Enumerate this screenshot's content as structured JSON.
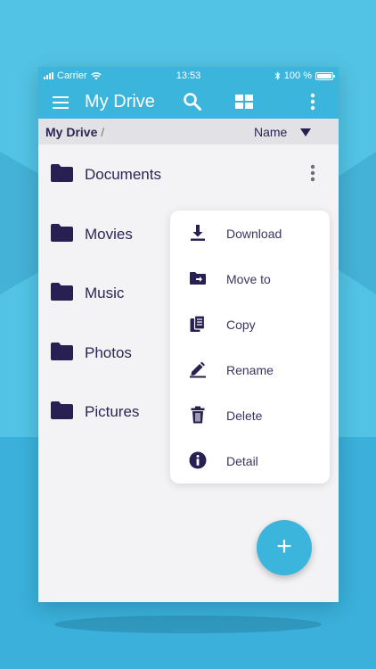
{
  "status_bar": {
    "carrier": "Carrier",
    "time": "13:53",
    "battery": "100 %"
  },
  "app_bar": {
    "title": "My Drive",
    "icons": [
      "menu-icon",
      "search-icon",
      "grid-view-icon",
      "more-vert-icon"
    ]
  },
  "breadcrumb": {
    "root": "My Drive",
    "separator": "/"
  },
  "sort": {
    "label": "Name",
    "direction_icon": "triangle-down-icon"
  },
  "folders": [
    {
      "name": "Documents"
    },
    {
      "name": "Movies"
    },
    {
      "name": "Music"
    },
    {
      "name": "Photos"
    },
    {
      "name": "Pictures"
    }
  ],
  "context_menu": [
    {
      "label": "Download",
      "icon": "download-icon"
    },
    {
      "label": "Move to",
      "icon": "move-to-folder-icon"
    },
    {
      "label": "Copy",
      "icon": "copy-icon"
    },
    {
      "label": "Rename",
      "icon": "rename-icon"
    },
    {
      "label": "Delete",
      "icon": "trash-icon"
    },
    {
      "label": "Detail",
      "icon": "info-icon"
    }
  ],
  "fab": {
    "label": "+"
  },
  "colors": {
    "accent": "#3cb5dc",
    "icon_dark": "#262152",
    "background": "#45b4da"
  }
}
